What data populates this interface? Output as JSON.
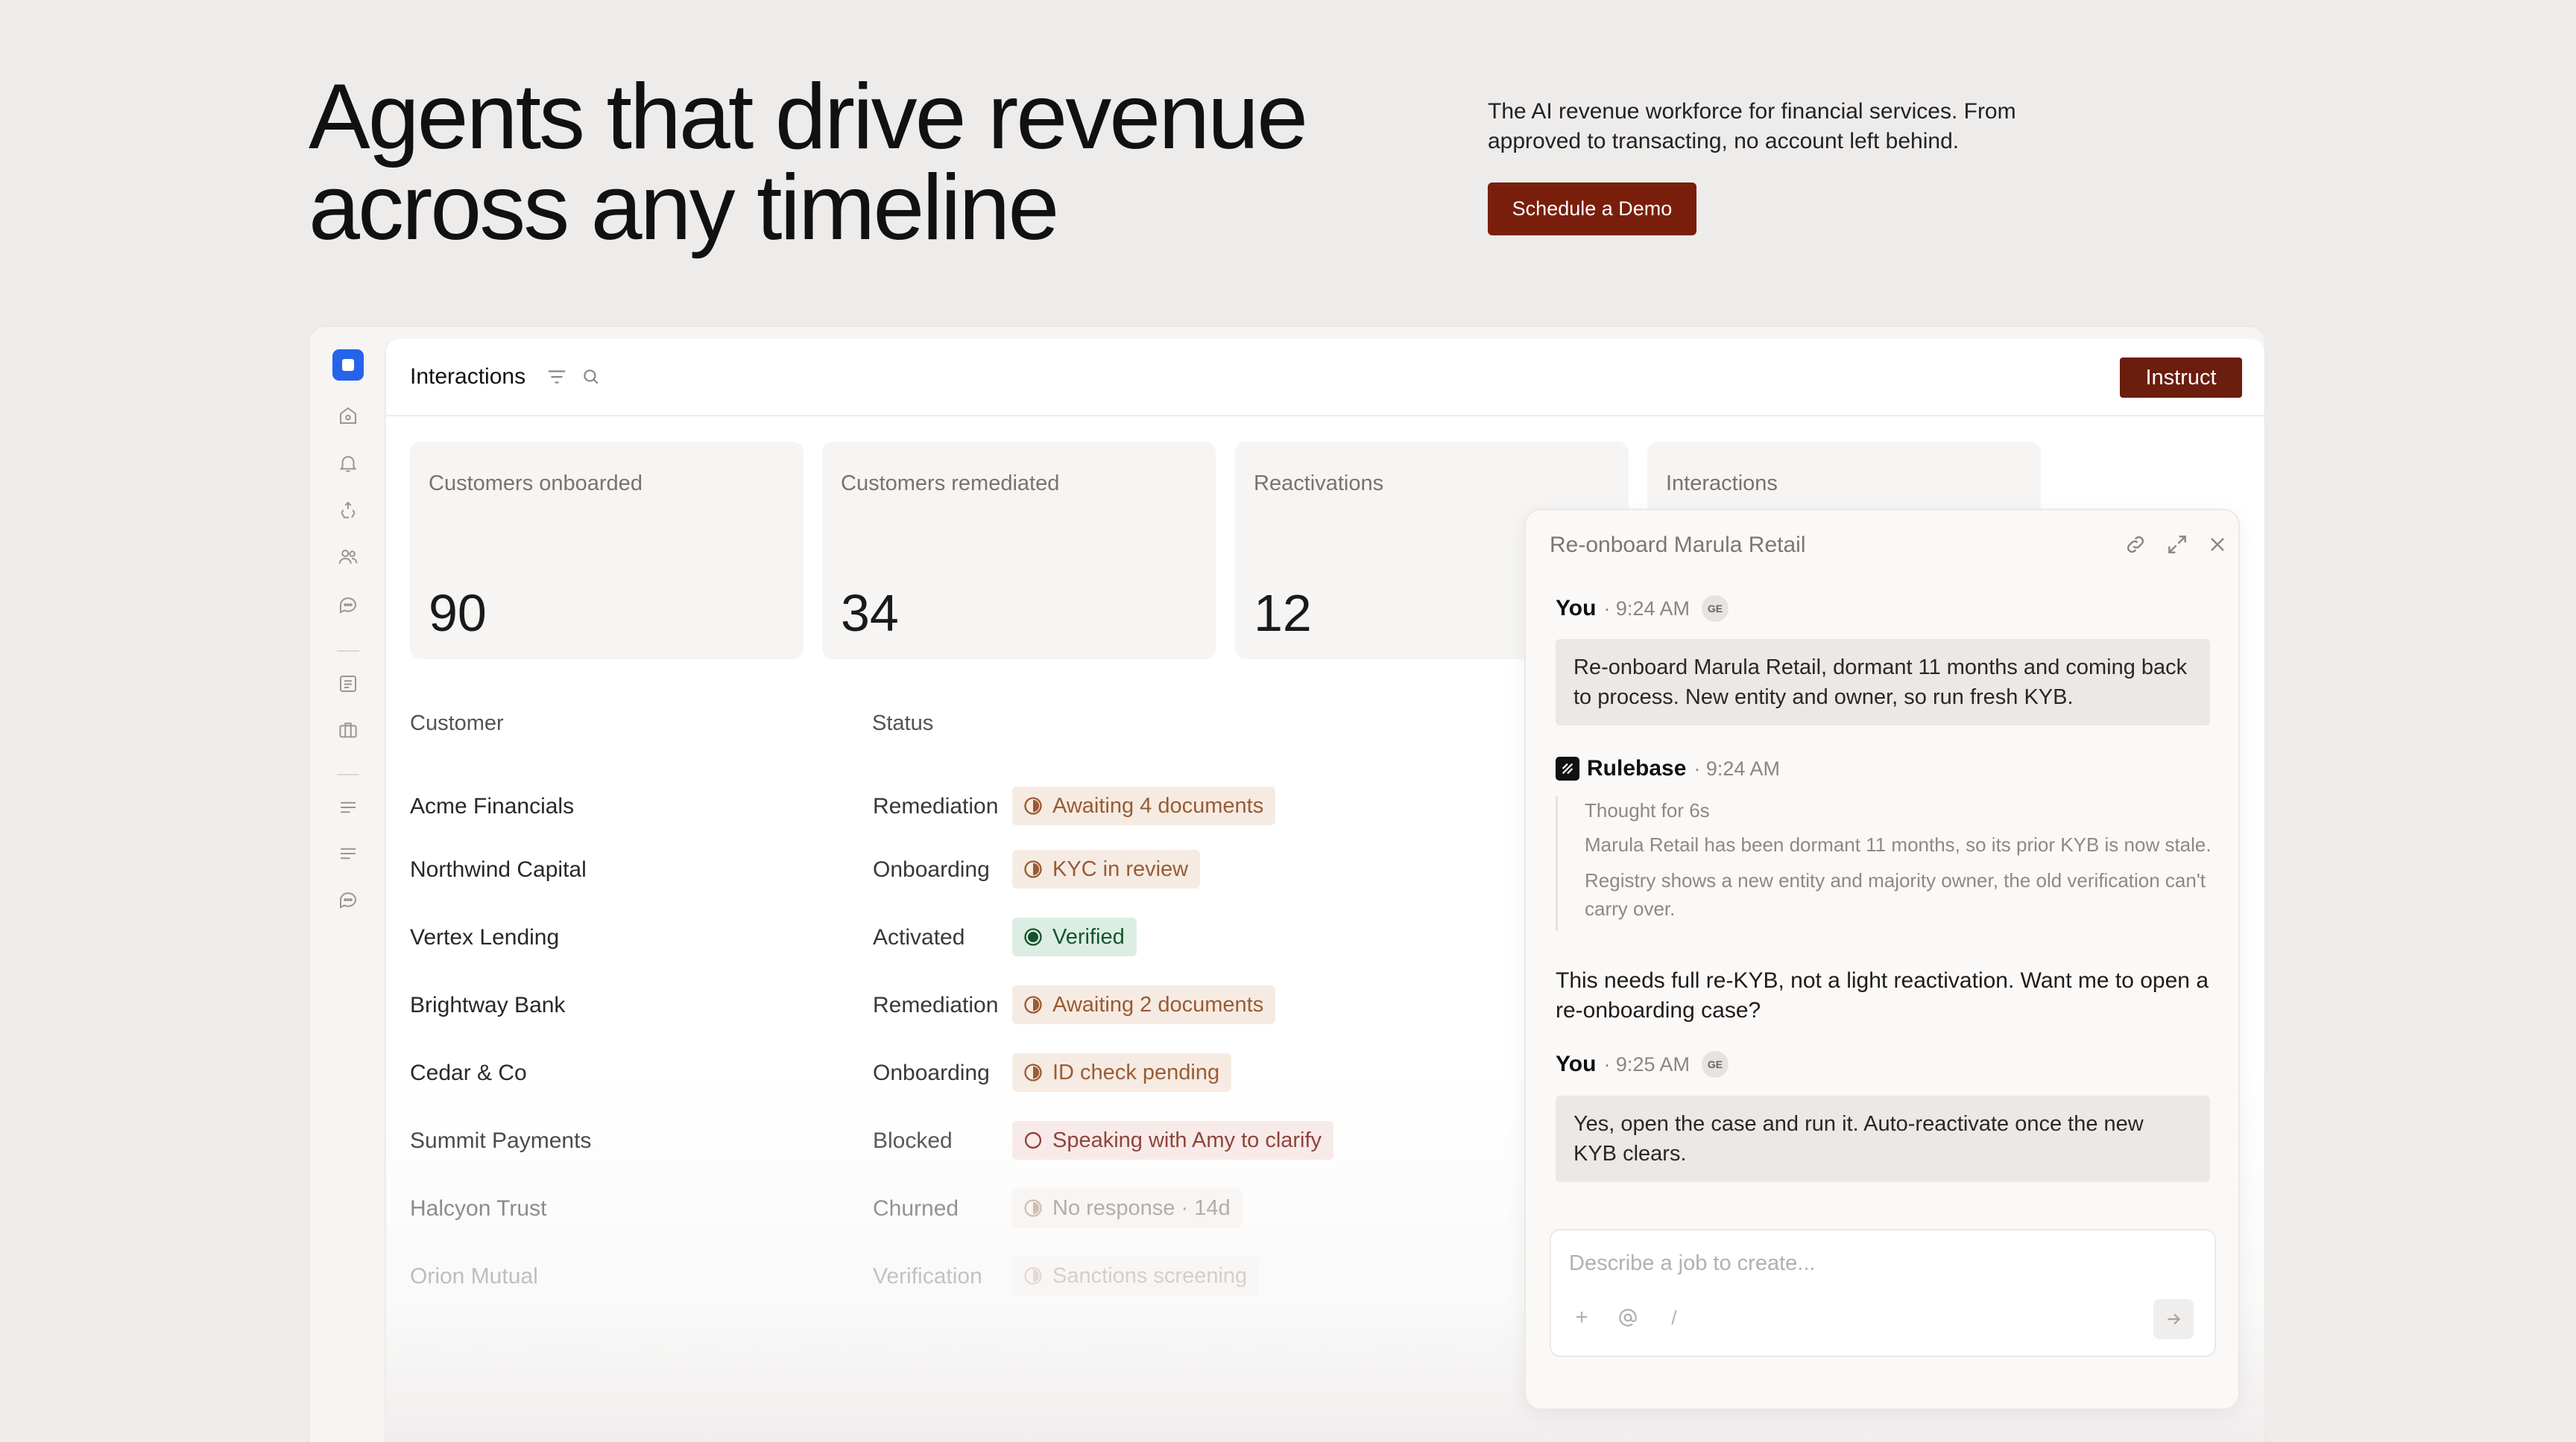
{
  "hero": {
    "title_line1": "Agents that drive revenue",
    "title_line2": "across any timeline",
    "description": "The AI revenue workforce for financial services. From approved to transacting, no account left behind.",
    "cta_label": "Schedule a Demo"
  },
  "colors": {
    "brand": "#7a1e0c",
    "rail_logo": "#2563eb",
    "pending_bg": "#f6ebe3",
    "pending_text": "#9a5b32",
    "verified_bg": "#dceee4",
    "verified_text": "#14532d",
    "blocked_bg": "#f7e8e6",
    "blocked_text": "#7a1e14"
  },
  "sidebar": {
    "icons": [
      "home-icon",
      "bell-icon",
      "recycle-icon",
      "users-icon",
      "chat-icon",
      "list-icon",
      "briefcase-icon",
      "lines-icon",
      "lines-icon",
      "chat-icon"
    ]
  },
  "topbar": {
    "title": "Interactions",
    "instruct_label": "Instruct"
  },
  "stats": [
    {
      "label": "Customers onboarded",
      "value": "90"
    },
    {
      "label": "Customers remediated",
      "value": "34"
    },
    {
      "label": "Reactivations",
      "value": "12"
    },
    {
      "label": "Interactions",
      "value": ""
    }
  ],
  "table": {
    "col_customer": "Customer",
    "col_status": "Status",
    "rows": [
      {
        "customer": "Acme Financials",
        "stage": "Remediation",
        "badge": "Awaiting 4 documents",
        "kind": "pending"
      },
      {
        "customer": "Northwind Capital",
        "stage": "Onboarding",
        "badge": "KYC in review",
        "kind": "pending"
      },
      {
        "customer": "Vertex Lending",
        "stage": "Activated",
        "badge": "Verified",
        "kind": "verified"
      },
      {
        "customer": "Brightway Bank",
        "stage": "Remediation",
        "badge": "Awaiting 2 documents",
        "kind": "pending"
      },
      {
        "customer": "Cedar & Co",
        "stage": "Onboarding",
        "badge": "ID check pending",
        "kind": "pending"
      },
      {
        "customer": "Summit Payments",
        "stage": "Blocked",
        "badge": "Speaking with Amy to clarify",
        "kind": "blocked"
      },
      {
        "customer": "Halcyon Trust",
        "stage": "Churned",
        "badge": "No response · 14d",
        "kind": "pending"
      },
      {
        "customer": "Orion Mutual",
        "stage": "Verification",
        "badge": "Sanctions screening",
        "kind": "pending"
      }
    ]
  },
  "chat": {
    "title": "Re-onboard Marula Retail",
    "msg1": {
      "author": "You",
      "time": "· 9:24 AM",
      "avatar": "GE",
      "text": "Re-onboard Marula Retail,  dormant 11 months and coming back to process. New entity and owner, so run fresh KYB."
    },
    "msg2": {
      "author": "Rulebase",
      "time": "· 9:24 AM",
      "thought_head": "Thought for 6s",
      "thought1": "Marula Retail has been dormant 11 months, so its prior KYB is now stale.",
      "thought2": "Registry shows a new entity and majority owner, the old verification can't carry over.",
      "text": "This needs full re-KYB, not a light reactivation. Want me to open a re-onboarding case?"
    },
    "msg3": {
      "author": "You",
      "time": "· 9:25 AM",
      "avatar": "GE",
      "text": "Yes, open the case and run it. Auto-reactivate once the new KYB clears."
    },
    "composer_placeholder": "Describe a job to create...",
    "composer_slash": "/"
  }
}
